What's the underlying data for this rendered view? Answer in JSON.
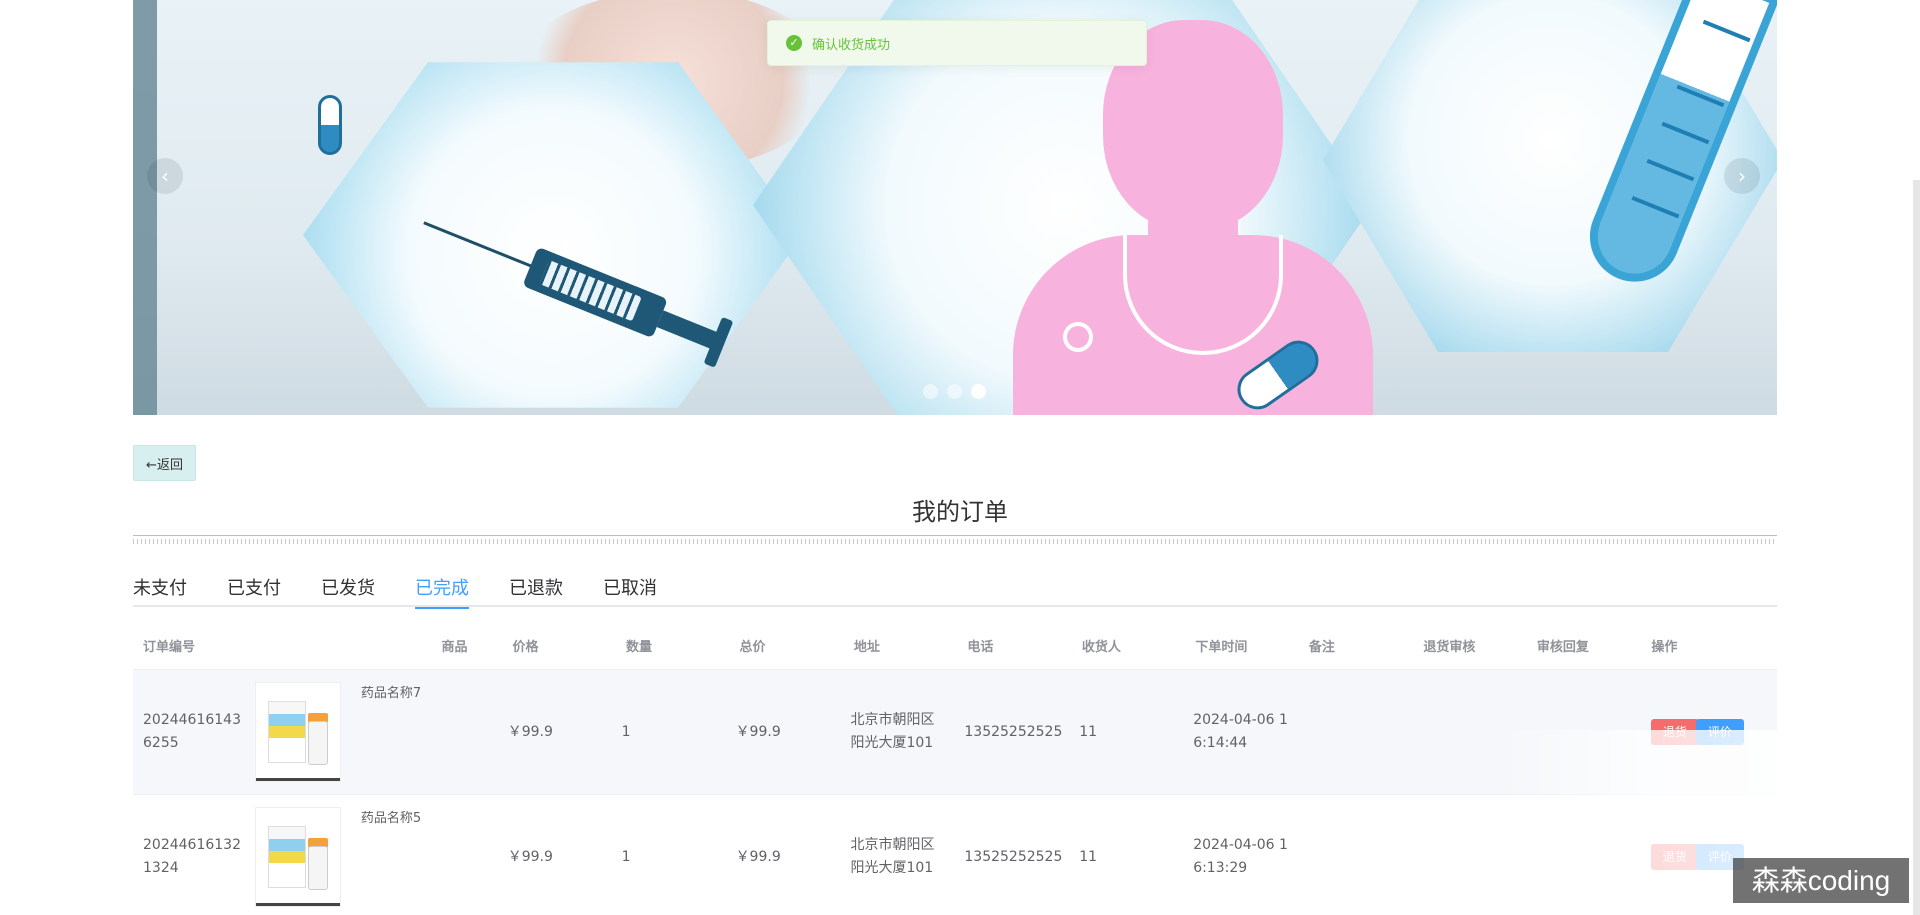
{
  "toast": {
    "message": "确认收货成功"
  },
  "back_button": {
    "label": "←返回"
  },
  "page_title": "我的订单",
  "tabs": [
    {
      "label": "未支付"
    },
    {
      "label": "已支付"
    },
    {
      "label": "已发货"
    },
    {
      "label": "已完成"
    },
    {
      "label": "已退款"
    },
    {
      "label": "已取消"
    }
  ],
  "active_tab": "已完成",
  "table": {
    "headers": [
      "订单编号",
      "商品",
      "价格",
      "数量",
      "总价",
      "地址",
      "电话",
      "收货人",
      "下单时间",
      "备注",
      "退货审核",
      "审核回复",
      "操作"
    ],
    "rows": [
      {
        "order_no_line1": "20244616143",
        "order_no_line2": "6255",
        "goods_name": "药品名称7",
        "price": "￥99.9",
        "quantity": "1",
        "total": "￥99.9",
        "address_line1": "北京市朝阳区",
        "address_line2": "阳光大厦101",
        "phone": "13525252525",
        "receiver": "11",
        "time_line1": "2024-04-06 1",
        "time_line2": "6:14:44",
        "remark": "",
        "return_review": "",
        "review_reply": "",
        "actions": {
          "refund": "退货",
          "review": "评价"
        }
      },
      {
        "order_no_line1": "20244616132",
        "order_no_line2": "1324",
        "goods_name": "药品名称5",
        "price": "￥99.9",
        "quantity": "1",
        "total": "￥99.9",
        "address_line1": "北京市朝阳区",
        "address_line2": "阳光大厦101",
        "phone": "13525252525",
        "receiver": "11",
        "time_line1": "2024-04-06 1",
        "time_line2": "6:13:29",
        "remark": "",
        "return_review": "",
        "review_reply": "",
        "actions": {
          "refund": "退货",
          "review": "评价"
        }
      }
    ]
  },
  "watermark": "森森coding",
  "colors": {
    "accent": "#409eff",
    "success": "#67c23a",
    "danger": "#f56c6c",
    "doctor": "#f8b2de"
  }
}
